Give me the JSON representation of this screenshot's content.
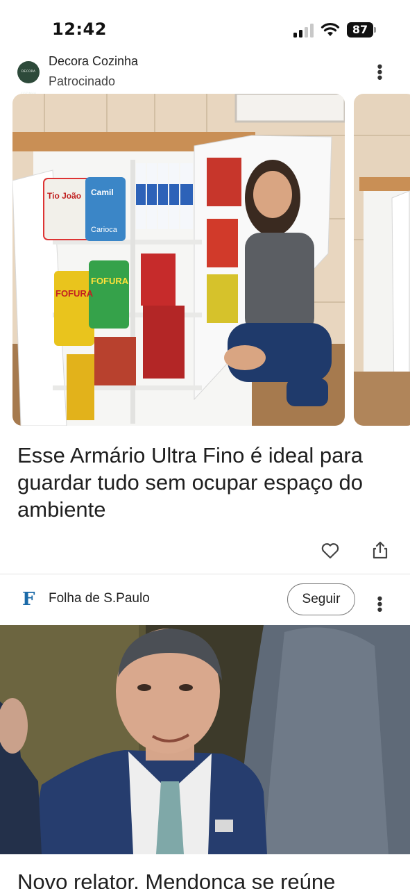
{
  "status_bar": {
    "time": "12:42",
    "battery": "87"
  },
  "ad": {
    "source_name": "Decora Cozinha",
    "logo_text": "DECORA COZINHA",
    "sponsored_label": "Patrocinado",
    "more_icon": "more-horizontal-icon",
    "product_labels": [
      "Tio João",
      "Camil",
      "Carioca",
      "FOFURA",
      "FOFURA"
    ],
    "headline": "Esse Armário Ultra Fino é ideal para guardar tudo sem ocupar espaço do ambiente",
    "like_icon": "heart-icon",
    "share_icon": "share-icon"
  },
  "article": {
    "publisher_logo": "F",
    "publisher_name": "Folha de S.Paulo",
    "follow_label": "Seguir",
    "more_icon": "more-horizontal-icon",
    "headline": "Novo relator, Mendonça se reúne"
  },
  "colors": {
    "accent_blue": "#1a6aa8",
    "ad_logo_bg": "#2d4a3a"
  }
}
